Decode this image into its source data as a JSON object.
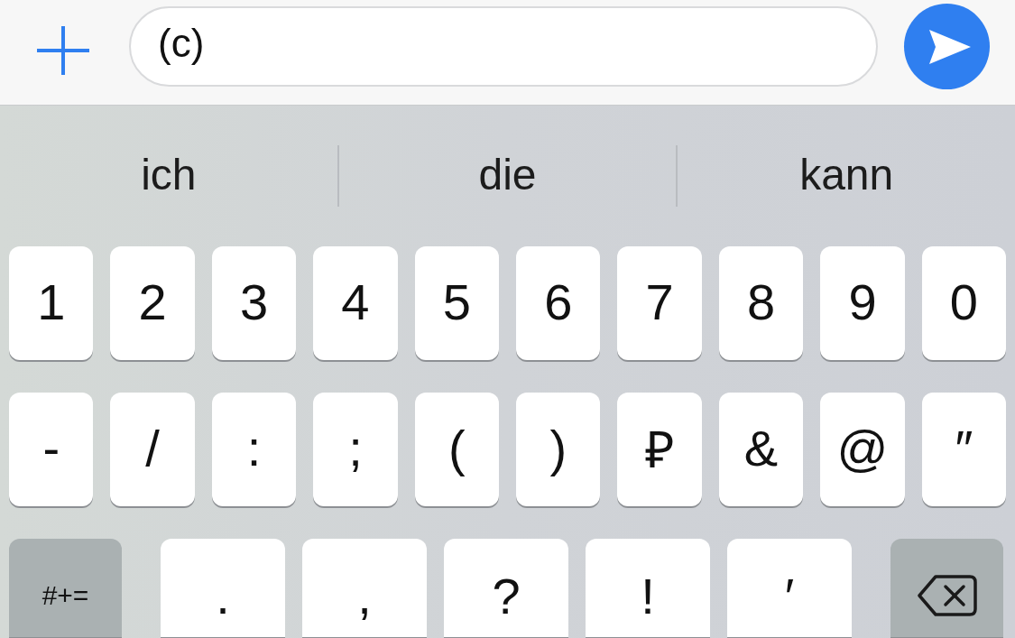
{
  "compose_bar": {
    "input": {
      "value": "(c)"
    }
  },
  "suggestions": [
    "ich",
    "die",
    "kann"
  ],
  "keyboard": {
    "rows": [
      [
        {
          "kind": "char",
          "label": "1"
        },
        {
          "kind": "char",
          "label": "2"
        },
        {
          "kind": "char",
          "label": "3"
        },
        {
          "kind": "char",
          "label": "4"
        },
        {
          "kind": "char",
          "label": "5"
        },
        {
          "kind": "char",
          "label": "6"
        },
        {
          "kind": "char",
          "label": "7"
        },
        {
          "kind": "char",
          "label": "8"
        },
        {
          "kind": "char",
          "label": "9"
        },
        {
          "kind": "char",
          "label": "0"
        }
      ],
      [
        {
          "kind": "char",
          "label": "-"
        },
        {
          "kind": "char",
          "label": "/"
        },
        {
          "kind": "char",
          "label": ":"
        },
        {
          "kind": "char",
          "label": ";"
        },
        {
          "kind": "char",
          "label": "("
        },
        {
          "kind": "char",
          "label": ")"
        },
        {
          "kind": "char",
          "label": "₽"
        },
        {
          "kind": "char",
          "label": "&"
        },
        {
          "kind": "char",
          "label": "@"
        },
        {
          "kind": "char",
          "label": "″"
        }
      ],
      [
        {
          "kind": "mode",
          "label": "#+="
        },
        {
          "kind": "char",
          "label": "."
        },
        {
          "kind": "char",
          "label": ","
        },
        {
          "kind": "char",
          "label": "?"
        },
        {
          "kind": "char",
          "label": "!"
        },
        {
          "kind": "char",
          "label": "′"
        },
        {
          "kind": "delete"
        }
      ]
    ]
  }
}
